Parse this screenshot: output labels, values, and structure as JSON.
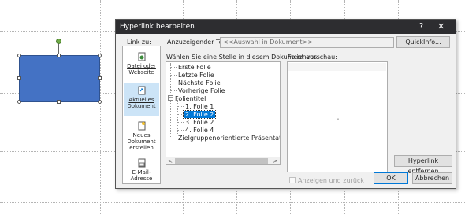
{
  "dialog": {
    "title": "Hyperlink bearbeiten",
    "help_glyph": "?",
    "close_glyph": "✕",
    "link_to_label": "Link zu:",
    "display_text_label": "Anzuzeigender Te",
    "display_text_label_ul": "x",
    "display_text_label_rest": "t:",
    "display_text_value": "<<Auswahl in Dokument>>",
    "quickinfo_button": "QuickInfo...",
    "place_label": "Wählen Sie eine Stelle in diesem Dokument aus:",
    "preview_label": "Folienvorschau:",
    "show_return_label": "Anzeigen und zurück",
    "remove_link_button_ul": "H",
    "remove_link_button_rest": "yperlink entfernen",
    "ok_button": "OK",
    "cancel_button": "Abbrechen"
  },
  "link_to_items": [
    {
      "line1": "Datei oder",
      "line2": "Webseite",
      "selected": false,
      "icon": "file-web-icon"
    },
    {
      "line1": "Aktuelles",
      "line2": "Dokument",
      "selected": true,
      "icon": "current-document-icon"
    },
    {
      "line1": "Neues",
      "line2": "Dokument",
      "line3": "erstellen",
      "selected": false,
      "icon": "new-document-icon"
    },
    {
      "line1": "E-Mail-Adresse",
      "selected": false,
      "icon": "email-icon"
    }
  ],
  "tree": {
    "items": [
      "Erste Folie",
      "Letzte Folie",
      "Nächste Folie",
      "Vorherige Folie",
      "Folientitel",
      "1. Folie 1",
      "2. Folie 2",
      "3. Folie 2",
      "4. Folie 4",
      "Zielgruppenorientierte Präsentationen"
    ],
    "selected_index": 6
  },
  "scroll": {
    "left_arrow": "<",
    "right_arrow": ">"
  },
  "colors": {
    "accent": "#0078d7",
    "shape_fill": "#4472c4",
    "titlebar": "#2d2d30"
  }
}
